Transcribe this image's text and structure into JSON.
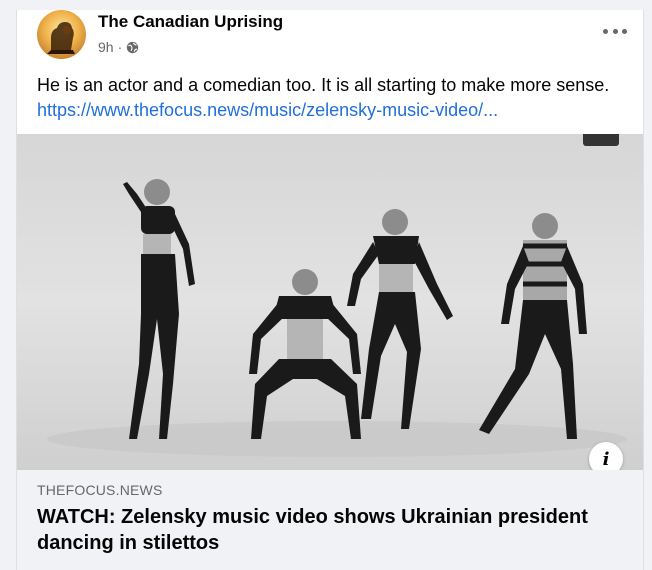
{
  "post": {
    "author": "The Canadian Uprising",
    "time": "9h",
    "separator": "·",
    "privacy_icon": "globe-icon",
    "more_icon": "more-options-icon",
    "text": "He is an actor and a comedian too. It is all starting to make more sense. ",
    "link_text": "https://www.thefocus.news/music/zelensky-music-video/..."
  },
  "link_preview": {
    "domain": "THEFOCUS.NEWS",
    "title": "WATCH: Zelensky music video shows Ukrainian president dancing in stilettos",
    "info_icon": "info-icon",
    "info_label": "i"
  },
  "colors": {
    "link": "#216fdb",
    "text": "#050505",
    "secondary": "#65676b",
    "preview_bg": "#f0f2f5"
  }
}
